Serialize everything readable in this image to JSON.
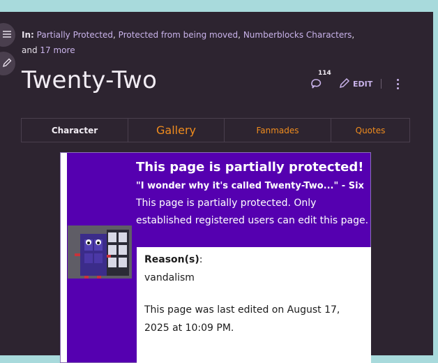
{
  "categories": {
    "label": "In:",
    "items": [
      "Partially Protected",
      "Protected from being moved",
      "Numberblocks Characters"
    ],
    "more_prefix": "and",
    "more_link": "17 more"
  },
  "page": {
    "title": "Twenty-Two"
  },
  "actions": {
    "comment_count": "114",
    "edit_label": "EDIT"
  },
  "tabs": [
    {
      "label": "Character"
    },
    {
      "label": "Gallery"
    },
    {
      "label": "Fanmades"
    },
    {
      "label": "Quotes"
    }
  ],
  "notice": {
    "heading": "This page is partially protected!",
    "quote": "\"I wonder why it's called Twenty-Two...\" - Six",
    "description": "This page is partially protected. Only established registered users can edit this page.",
    "reason_label": "Reason(s)",
    "reason_colon": ":",
    "reason_value": "vandalism",
    "last_edited": "This page was last edited on August 17, 2025 at 10:09 PM."
  },
  "colors": {
    "accent_orange": "#f08c1e",
    "link_purple": "#c9b3ea",
    "notice_purple": "#5500b0"
  }
}
